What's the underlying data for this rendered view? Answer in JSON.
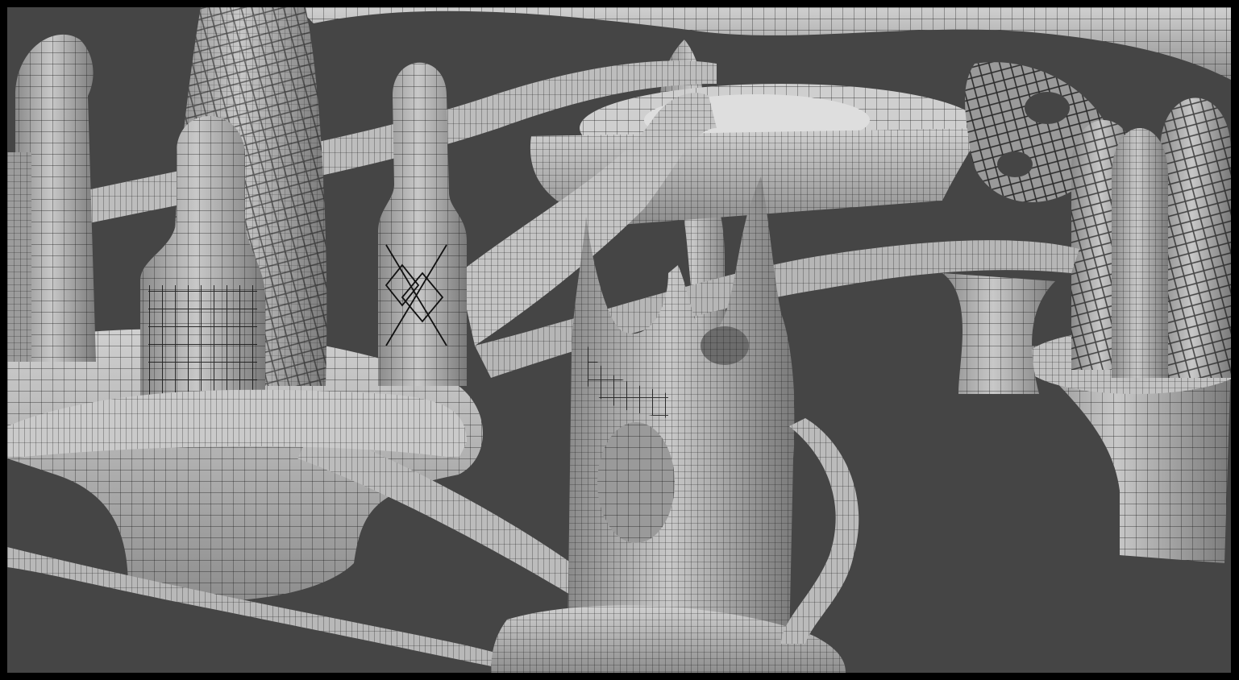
{
  "viewport": {
    "background_color": "#454545",
    "frame_color": "#000000",
    "surface_color": "#b8b8b8",
    "surface_light_color": "#d4d4d4",
    "surface_dark_color": "#7c7c7c",
    "wire_color": "#1a1a1a",
    "shading_mode": "wireframe-on-shaded"
  },
  "scene": {
    "objects": [
      "left-tower-cluster",
      "tall-tapered-spire",
      "left-domed-pillar",
      "front-left-pillar",
      "center-pillar-with-diamonds",
      "curved-bridge-ramp",
      "central-spire-cluster",
      "right-arched-towers",
      "back-organic-canopy",
      "upper-center-basin",
      "right-lattice-structure",
      "lower-left-pedestal",
      "right-pedestal",
      "lower-center-base"
    ]
  }
}
